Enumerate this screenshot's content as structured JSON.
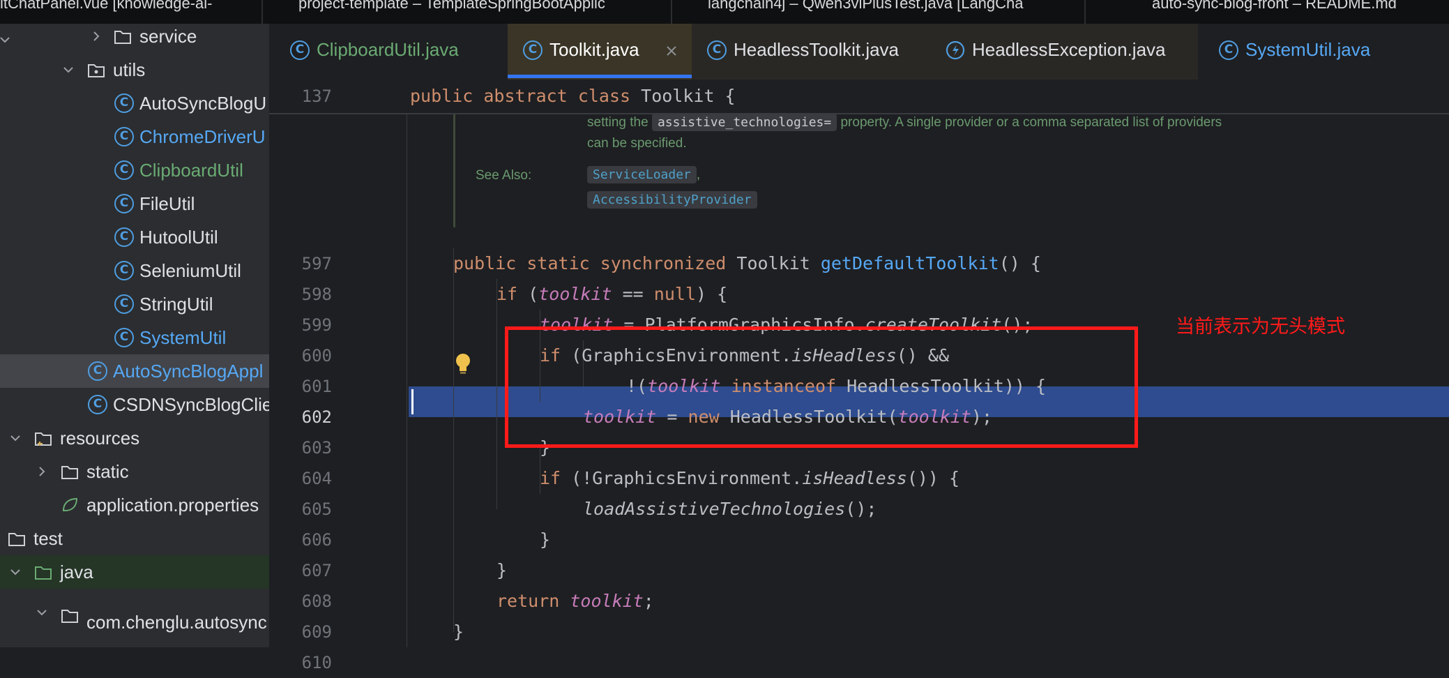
{
  "window_tabs": [
    "itChatPanel.vue [knowledge-ai-",
    "project-template – TemplateSpringBootApplic",
    "langchain4j – Qwen3vlPlusTest.java [LangCha",
    "auto-sync-blog-front – README.md"
  ],
  "sidebar": {
    "items": [
      {
        "label": "service"
      },
      {
        "label": "utils"
      },
      {
        "label": "AutoSyncBlogU"
      },
      {
        "label": "ChromeDriverU"
      },
      {
        "label": "ClipboardUtil"
      },
      {
        "label": "FileUtil"
      },
      {
        "label": "HutoolUtil"
      },
      {
        "label": "SeleniumUtil"
      },
      {
        "label": "StringUtil"
      },
      {
        "label": "SystemUtil"
      },
      {
        "label": "AutoSyncBlogAppl"
      },
      {
        "label": "CSDNSyncBlogClie"
      },
      {
        "label": "resources"
      },
      {
        "label": "static"
      },
      {
        "label": "application.properties"
      },
      {
        "label": "test"
      },
      {
        "label": "java"
      },
      {
        "label": "com.chenglu.autosync"
      }
    ]
  },
  "editor_tabs": [
    {
      "label": "ClipboardUtil.java",
      "active": false
    },
    {
      "label": "Toolkit.java",
      "active": true
    },
    {
      "label": "HeadlessToolkit.java",
      "active": false
    },
    {
      "label": "HeadlessException.java",
      "active": false
    },
    {
      "label": "SystemUtil.java",
      "active": false
    }
  ],
  "editor": {
    "sticky_line_number": "137",
    "sticky_line": "public abstract class Toolkit {",
    "doc": {
      "line1_prefix": "setting the",
      "line1_code": "assistive_technologies=",
      "line1_suffix": "property. A single provider or a comma separated list of providers",
      "line2": "can be specified.",
      "see_also_label": "See Also:",
      "see_also_1": "ServiceLoader",
      "see_also_sep": ",",
      "see_also_2": "AccessibilityProvider"
    },
    "line_numbers": [
      "597",
      "598",
      "599",
      "600",
      "601",
      "602",
      "603",
      "604",
      "605",
      "606",
      "607",
      "608",
      "609",
      "610"
    ],
    "annotation": "当前表示为无头模式"
  },
  "colors": {
    "annotation_red": "#ff1a1a",
    "selection": "#2e4c8f",
    "accent_tab": "#3574f0",
    "modified_green": "#6aab73"
  }
}
